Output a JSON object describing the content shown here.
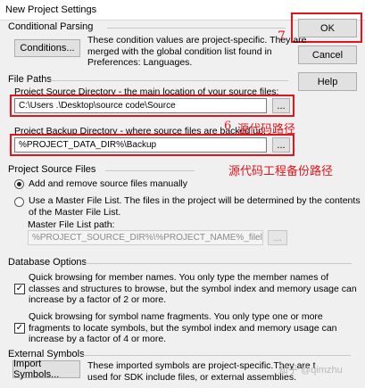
{
  "window": {
    "title": "New Project Settings"
  },
  "buttons": {
    "ok": "OK",
    "cancel": "Cancel",
    "help": "Help",
    "conditions": "Conditions...",
    "browse": "...",
    "import_symbols": "Import Symbols..."
  },
  "conditional_parsing": {
    "title": "Conditional Parsing",
    "description": [
      "These condition values are project-specific.  They are",
      "merged with the global condition list found in",
      "Preferences: Languages."
    ]
  },
  "file_paths": {
    "title": "File Paths",
    "source_label": "Project Source Directory - the main location of your source files:",
    "source_value": "C:\\Users        .\\Desktop\\source code\\Source",
    "backup_label": "Project Backup Directory - where source files are backed up:",
    "backup_value": "%PROJECT_DATA_DIR%\\Backup"
  },
  "project_source_files": {
    "title": "Project Source Files",
    "radio_add": "Add and remove source files manually",
    "radio_master": [
      "Use a Master File List. The files in the project will be determined by the contents",
      "of the Master File List."
    ],
    "master_path_label": "Master File List path:",
    "master_path_value": "%PROJECT_SOURCE_DIR%\\%PROJECT_NAME%_filelist.txt"
  },
  "database_options": {
    "title": "Database Options",
    "option1": [
      "Quick browsing for member names.  You only type the member names of",
      "classes and structures to browse, but the symbol index and memory usage can",
      "increase by a factor of 2 or more."
    ],
    "option2": [
      "Quick browsing for symbol name fragments.  You only type one or more",
      "fragments to locate symbols, but the symbol index and memory usage can",
      "increase by a factor of 4 or more."
    ]
  },
  "external_symbols": {
    "title": "External Symbols",
    "description": [
      "These imported symbols are project-specific.They are t",
      "used for SDK include files, or external assemblies."
    ]
  },
  "annotations": {
    "seven": "7",
    "six": "6",
    "source_path_note": "源代码路径",
    "backup_path_note": "源代码工程备份路径"
  },
  "watermark": "知乎 @qimzhu",
  "colors": {
    "annotation_red": "#e0161c",
    "dialog_bg": "#f0f0f0"
  }
}
